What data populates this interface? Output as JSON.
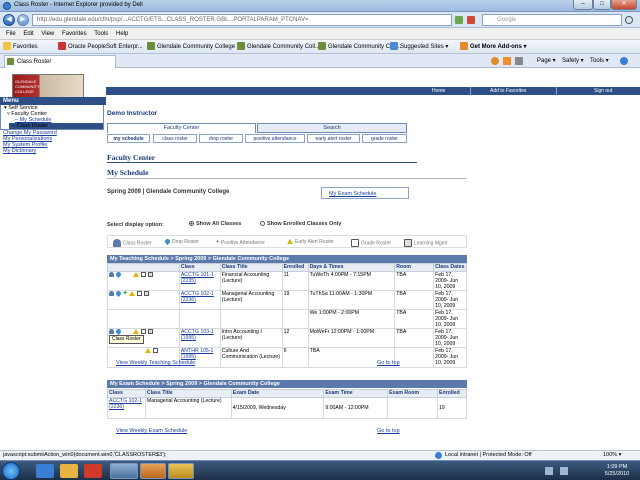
{
  "window": {
    "title": "Class Roster - Internet Explorer provided by Dell",
    "btn_min": "–",
    "btn_max": "□",
    "btn_close": "✕"
  },
  "address": {
    "url": "http://edu.glendale.edu/cfm/psp/...ACCTG/ETS...CLASS_ROSTER.GBL...PORTALPARAM_PTCNAV=",
    "search_placeholder": "Google",
    "back": "◀",
    "fwd": "▶"
  },
  "menubar": [
    "File",
    "Edit",
    "View",
    "Favorites",
    "Tools",
    "Help"
  ],
  "favorites": {
    "label": "Favorites",
    "items": [
      "Oracle PeopleSoft Enterpr...",
      "Glendale Community College",
      "Glendale Community Coll...",
      "Glendale Community Coll...",
      "Suggested Sites ▾",
      "Get More Add-ons ▾"
    ]
  },
  "tab": {
    "label": "Class Roster"
  },
  "tools": [
    "Page ▾",
    "Safety ▾",
    "Tools ▾"
  ],
  "logo": {
    "text": "GLENDALE COMMUNITY COLLEGE"
  },
  "topnav": {
    "home": "Home",
    "add_fav": "Add to Favorites",
    "signout": "Sign out"
  },
  "leftmenu": {
    "header": "Menu",
    "self_service": "▾ Self Service",
    "faculty_center": "▿ Faculty Center",
    "my_schedule": "– My Schedule",
    "class_roster": "– Class Roster",
    "links": [
      "Change My Password",
      "My Personalizations",
      "My System Profile",
      "My Dictionary"
    ]
  },
  "page": {
    "instructor": "Demo Instructor",
    "tabs": [
      "Faculty Center",
      "Search"
    ],
    "subtabs": [
      "my schedule",
      "class roster",
      "drop roster",
      "positive attendance",
      "early alert roster",
      "grade roster"
    ],
    "faculty_center_title": "Faculty Center",
    "my_schedule_title": "My Schedule",
    "term": "Spring 2009 | Glendale Community College",
    "exam_schedule_link": "My Exam Schedule",
    "display_option_label": "Select display option:",
    "opt_all": "Show All Classes",
    "opt_enrolled": "Show Enrolled Classes Only",
    "legend": [
      "Class Roster",
      "Drop Roster",
      "Positive Attendance",
      "Early Alert Roster",
      "Grade Roster",
      "Learning Mgmt"
    ]
  },
  "teaching": {
    "header": "My Teaching Schedule > Spring 2009 > Glendale Community College",
    "columns": [
      "",
      "Class",
      "Class Title",
      "Enrolled",
      "Days & Times",
      "Room",
      "Class Dates"
    ],
    "rows": [
      {
        "class": "ACCTG 101-1 (2235)",
        "title": "Financial Accounting (Lecture)",
        "enrolled": "11",
        "times": "TuWeTh 4:00PM - 7:15PM",
        "room": "TBA",
        "dates": "Feb 17, 2009- Jun 10, 2009"
      },
      {
        "class": "ACCTG 102-1 (2236)",
        "title": "Managerial Accounting (Lecture)",
        "enrolled": "19",
        "times": "TuThSa 11:00AM - 1:30PM",
        "room": "TBA",
        "dates": "Feb 17, 2009- Jun 10, 2009"
      },
      {
        "class": "",
        "title": "",
        "enrolled": "",
        "times": "We 1:00PM - 2:00PM",
        "room": "TBA",
        "dates": "Feb 17, 2009- Jun 10, 2009"
      },
      {
        "class": "ACCTG 103-1 (1995)",
        "title": "Intro Accounting I (Lecture)",
        "enrolled": "12",
        "times": "MoWeFr 12:00PM - 1:00PM",
        "room": "TBA",
        "dates": "Feb 17, 2009- Jun 10, 2009"
      },
      {
        "class": "ANTHR 105-1 (1995)",
        "title": "Culture And Communication (Lecture)",
        "enrolled": "6",
        "times": "TBA",
        "room": "",
        "dates": "Feb 17, 2009- Jun 10, 2009"
      }
    ],
    "view_weekly": "View Weekly Teaching Schedule",
    "go_top": "Go to top",
    "tooltip": "Class Roster"
  },
  "exam": {
    "header": "My Exam Schedule > Spring 2009 > Glendale Community College",
    "columns": [
      "Class",
      "Class Title",
      "Exam Date",
      "Exam Time",
      "Exam Room",
      "Enrolled"
    ],
    "rows": [
      {
        "class": "ACCTG 102-1 (2236)",
        "title": "Managerial Accounting (Lecture)",
        "date": "4/15/2009, Wednesday",
        "time": "9:00AM - 12:00PM",
        "room": "",
        "enrolled": "19"
      }
    ],
    "view_weekly": "View Weekly Exam Schedule",
    "go_top": "Go to top"
  },
  "status": {
    "left": "javascript:submitAction_win0(document.win0,'CLASSROSTER$3');",
    "zone": "Local intranet | Protected Mode: Off",
    "zoom": "100% ▾"
  },
  "clock": {
    "time": "1:09 PM",
    "date": "5/25/2010"
  }
}
